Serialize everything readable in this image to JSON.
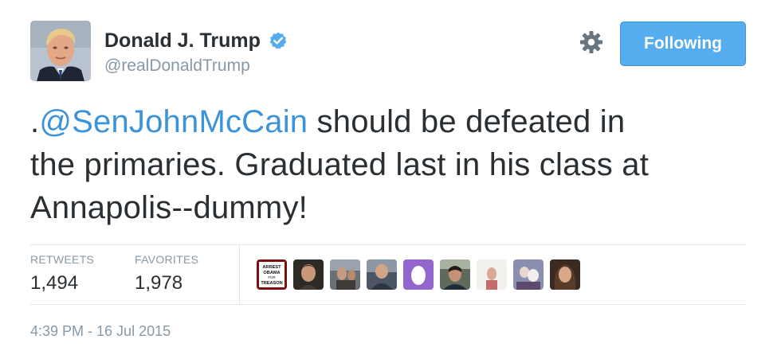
{
  "author": {
    "display_name": "Donald J. Trump",
    "handle": "@realDonaldTrump",
    "verified": true,
    "avatar_icon": "profile-photo"
  },
  "actions": {
    "follow_label": "Following",
    "settings_icon": "gear-icon"
  },
  "tweet": {
    "prefix": ".",
    "mention": "@SenJohnMcCain",
    "line1_rest": " should be defeated in",
    "line2": "the primaries. Graduated last in his class at",
    "line3": "Annapolis--dummy!"
  },
  "stats": {
    "retweets_label": "RETWEETS",
    "retweets_value": "1,494",
    "favorites_label": "FAVORITES",
    "favorites_value": "1,978"
  },
  "favoriters": {
    "first_avatar_text": [
      "ARREST",
      "OBAMA",
      "FOR",
      "TREASON"
    ]
  },
  "timestamp": "4:39 PM - 16 Jul 2015",
  "colors": {
    "accent": "#55acee",
    "mention": "#3b94d9",
    "muted": "#8899a6",
    "text": "#292f33",
    "divider": "#e1e8ed"
  }
}
